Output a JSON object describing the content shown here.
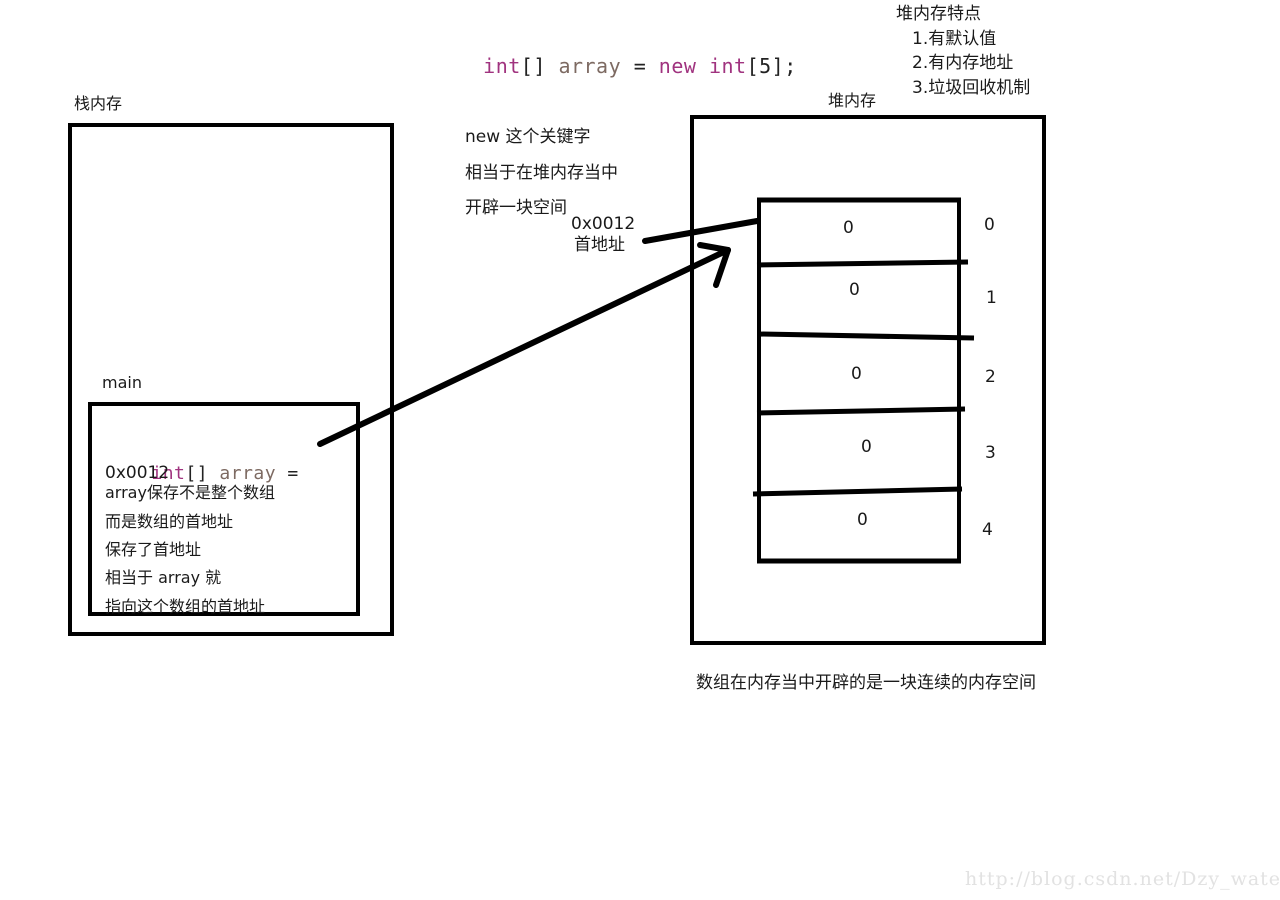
{
  "code_statement": {
    "tokens": [
      {
        "text": "int",
        "kind": "keyword"
      },
      {
        "text": "[]",
        "kind": "punct"
      },
      {
        "text": " ",
        "kind": "punct"
      },
      {
        "text": "array",
        "kind": "identifier"
      },
      {
        "text": " = ",
        "kind": "punct"
      },
      {
        "text": "new",
        "kind": "keyword"
      },
      {
        "text": " ",
        "kind": "punct"
      },
      {
        "text": "int",
        "kind": "keyword"
      },
      {
        "text": "[5];",
        "kind": "punct"
      }
    ],
    "full_text": "int[] array = new int[5];"
  },
  "heap_features": {
    "title": "堆内存特点",
    "items": [
      "1.有默认值",
      "2.有内存地址",
      "3.垃圾回收机制"
    ]
  },
  "stack": {
    "label": "栈内存",
    "frame_label": "main",
    "frame_code": {
      "tokens": [
        {
          "text": "int",
          "kind": "keyword"
        },
        {
          "text": "[]",
          "kind": "punct"
        },
        {
          "text": " ",
          "kind": "punct"
        },
        {
          "text": "array",
          "kind": "identifier"
        },
        {
          "text": " =",
          "kind": "punct"
        }
      ],
      "full_text": "int[] array ="
    },
    "frame_value": "0x0012",
    "frame_notes": [
      "array保存不是整个数组",
      "而是数组的首地址",
      "保存了首地址",
      "相当于 array 就",
      "指向这个数组的首地址"
    ]
  },
  "middle_notes": {
    "lines": [
      "new 这个关键字",
      "相当于在堆内存当中",
      "开辟一块空间"
    ],
    "address_value": "0x0012",
    "address_label": "首地址"
  },
  "heap": {
    "label": "堆内存",
    "caption": "数组在内存当中开辟的是一块连续的内存空间",
    "array_cells": [
      {
        "value": "0",
        "index": "0"
      },
      {
        "value": "0",
        "index": "1"
      },
      {
        "value": "0",
        "index": "2"
      },
      {
        "value": "0",
        "index": "3"
      },
      {
        "value": "0",
        "index": "4"
      }
    ]
  },
  "watermark": "http://blog.csdn.net/Dzy_water",
  "colors": {
    "keyword": "#a0337f",
    "identifier": "#7d6a62",
    "ink": "#000000",
    "text": "#1a1a1a",
    "watermark": "#e2e2e2"
  }
}
